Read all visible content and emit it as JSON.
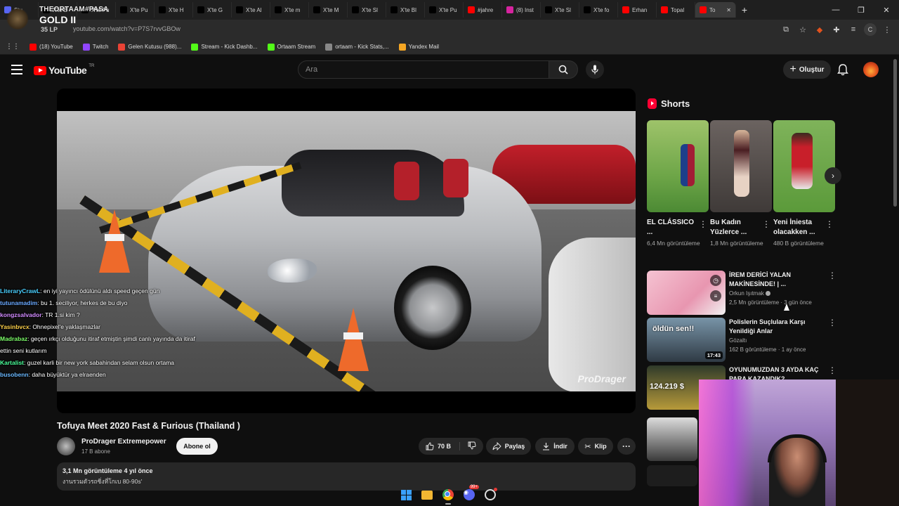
{
  "browser": {
    "tabs": [
      {
        "label": "Stu",
        "icon": "discord-tab-icon",
        "color": "#5865f2"
      },
      {
        "label": "X'te B",
        "icon": "x-tab-icon",
        "color": "#000000"
      },
      {
        "label": "X'te Pu",
        "icon": "x-tab-icon",
        "color": "#000000"
      },
      {
        "label": "X'te Pu",
        "icon": "x-tab-icon",
        "color": "#000000"
      },
      {
        "label": "X'te H",
        "icon": "x-tab-icon",
        "color": "#000000"
      },
      {
        "label": "X'te G",
        "icon": "x-tab-icon",
        "color": "#000000"
      },
      {
        "label": "X'te Al",
        "icon": "x-tab-icon",
        "color": "#000000"
      },
      {
        "label": "X'te m",
        "icon": "x-tab-icon",
        "color": "#000000"
      },
      {
        "label": "X'te M",
        "icon": "x-tab-icon",
        "color": "#000000"
      },
      {
        "label": "X'te Sl",
        "icon": "x-tab-icon",
        "color": "#000000"
      },
      {
        "label": "X'te Bl",
        "icon": "x-tab-icon",
        "color": "#000000"
      },
      {
        "label": "X'te Pu",
        "icon": "x-tab-icon",
        "color": "#000000"
      },
      {
        "label": "#jahre",
        "icon": "youtube-tab-icon",
        "color": "#ff0000"
      },
      {
        "label": "(8) Inst",
        "icon": "instagram-tab-icon",
        "color": "#d6249f"
      },
      {
        "label": "X'te Sl",
        "icon": "x-tab-icon",
        "color": "#000000"
      },
      {
        "label": "X'te fo",
        "icon": "x-tab-icon",
        "color": "#000000"
      },
      {
        "label": "Erhan",
        "icon": "youtube-tab-icon",
        "color": "#ff0000"
      },
      {
        "label": "Topal",
        "icon": "youtube-tab-icon",
        "color": "#ff0000"
      },
      {
        "label": "To",
        "icon": "youtube-tab-icon",
        "color": "#ff0000",
        "active": true
      }
    ],
    "url": "youtube.com/watch?v=P7S7rvvGBOw",
    "profile_letter": "C",
    "bookmarks": [
      {
        "label": "(18) YouTube",
        "color": "#ff0000"
      },
      {
        "label": "Twitch",
        "color": "#9146ff"
      },
      {
        "label": "Gelen Kutusu (988)...",
        "color": "#ea4335"
      },
      {
        "label": "Stream - Kick Dashb...",
        "color": "#53fc18"
      },
      {
        "label": "Ortaam Stream",
        "color": "#53fc18"
      },
      {
        "label": "ortaam - Kick Stats,...",
        "color": "#888888"
      },
      {
        "label": "Yandex Mail",
        "color": "#f5a623"
      }
    ]
  },
  "rank_overlay": {
    "team": "THEORTAAM#PASA",
    "rank": "GOLD II",
    "lp": "35 LP"
  },
  "youtube": {
    "logo_text": "YouTube",
    "logo_region": "TR",
    "search_placeholder": "Ara",
    "create_label": "Oluştur",
    "accent": "#ff0000"
  },
  "video": {
    "title": "Tofuya Meet 2020 Fast & Furious (Thailand )",
    "watermark": "ProDrager",
    "channel": "ProDrager Extremepower",
    "subscribers": "17 B abone",
    "subscribe_label": "Abone ol",
    "likes": "70 B",
    "share_label": "Paylaş",
    "download_label": "İndir",
    "clip_label": "Klip",
    "views_meta": "3,1 Mn görüntüleme  4 yıl önce",
    "description": "งานรวมตัวรถซิ่งที่โกเบ 80-90s'"
  },
  "chat": [
    {
      "user": "LiteraryCrawL",
      "color": "#4ad0ff",
      "text": ": en iyi yayıncı ödülünü aldı speed geçen gün"
    },
    {
      "user": "tutunamadim",
      "color": "#6aa9ff",
      "text": ": bu 1. seciliyor, herkes de bu diyo"
    },
    {
      "user": "kongzsalvador",
      "color": "#d28bff",
      "text": ": TR 1.si kim ?"
    },
    {
      "user": "Yasinbvcx",
      "color": "#ffd24a",
      "text": ": Ohnepixel'e yaklaşmazlar"
    },
    {
      "user": "Madrabaz",
      "color": "#7dff6a",
      "text": ": geçen ırkçı olduğunu itiraf etmiştin şimdi canlı yayında da itiraf"
    },
    {
      "user": "",
      "color": "#ffffff",
      "text": "ettin seni kutlarım"
    },
    {
      "user": "Kartalist",
      "color": "#4aff9a",
      "text": ": guzel karli bir new york sabahindan selam olsun ortama"
    },
    {
      "user": "busobenn",
      "color": "#6ab8ff",
      "text": ": daha büyüktür ya elraenden"
    }
  ],
  "shorts": {
    "title": "Shorts",
    "items": [
      {
        "title": "EL CLÁSSICO ...",
        "views": "6,4 Mn görüntüleme"
      },
      {
        "title": "Bu Kadın Yüzlerce ...",
        "views": "1,8 Mn görüntüleme"
      },
      {
        "title": "Yeni İniesta olacakken ...",
        "views": "480 B görüntüleme"
      }
    ]
  },
  "related": [
    {
      "title": "İREM DERİCİ YALAN MAKİNESİNDE! | ...",
      "channel": "Orkun Işıtmak",
      "meta": "2,5 Mn görüntüleme · 3 gün önce",
      "duration": ""
    },
    {
      "title": "Polislerin Suçlulara Karşı Yenildiği Anlar",
      "channel": "Gözaltı",
      "meta": "162 B görüntüleme · 1 ay önce",
      "duration": "17:43",
      "thumb_text": "öldün sen!!"
    },
    {
      "title": "OYUNUMUZDAN 3 AYDA KAÇ PARA KAZANDIK?",
      "channel": "",
      "meta": "",
      "duration": "",
      "thumb_text": "124.219 $"
    }
  ],
  "taskbar": {
    "discord_badge": "99+"
  }
}
